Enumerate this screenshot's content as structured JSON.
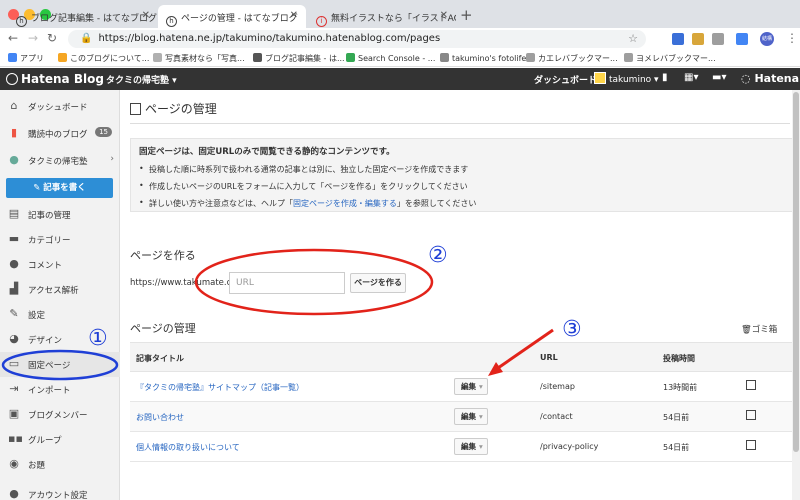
{
  "browser": {
    "tabs": [
      {
        "title": "ブログ記事編集 - はてなブログ",
        "active": false
      },
      {
        "title": "ページの管理 - はてなブログ",
        "active": true
      },
      {
        "title": "無料イラストなら「イラストAC」",
        "active": false
      }
    ],
    "url": "https://blog.hatena.ne.jp/takumino/takumino.hatenablog.com/pages",
    "bookmarks": [
      "アプリ",
      "このブログについて...",
      "写真素材なら「写真...",
      "ブログ記事編集 - は...",
      "Search Console - ...",
      "takumino's fotolife",
      "カエレバブックマー...",
      "ヨメレバブックマー..."
    ],
    "avatar_text": "結構"
  },
  "header": {
    "logo": "Hatena Blog",
    "blog_name": "タクミの帰宅塾",
    "dashboard": "ダッシュボード",
    "user": "takumino",
    "brand": "Hatena"
  },
  "sidebar": {
    "items": [
      {
        "label": "ダッシュボード",
        "icon": "home-icon"
      },
      {
        "label": "購読中のブログ",
        "icon": "bookmark-icon",
        "badge": "15"
      },
      {
        "label": "タクミの帰宅塾",
        "icon": "blog-icon"
      },
      {
        "label": "記事の管理",
        "icon": "document-icon"
      },
      {
        "label": "カテゴリー",
        "icon": "folder-icon"
      },
      {
        "label": "コメント",
        "icon": "comment-icon"
      },
      {
        "label": "アクセス解析",
        "icon": "chart-icon"
      },
      {
        "label": "設定",
        "icon": "wrench-icon"
      },
      {
        "label": "デザイン",
        "icon": "palette-icon"
      },
      {
        "label": "固定ページ",
        "icon": "page-icon"
      },
      {
        "label": "インポート",
        "icon": "import-icon"
      },
      {
        "label": "ブログメンバー",
        "icon": "members-icon"
      },
      {
        "label": "グループ",
        "icon": "group-icon"
      },
      {
        "label": "お題",
        "icon": "topic-icon"
      },
      {
        "label": "アカウント設定",
        "icon": "account-icon"
      }
    ],
    "write_button": "記事を書く"
  },
  "main": {
    "title": "ページの管理",
    "info": {
      "lead": "固定ページは、固定URLのみで閲覧できる静的なコンテンツです。",
      "bullet1": "投稿した順に時系列で扱われる通常の記事とは別に、独立した固定ページを作成できます",
      "bullet2": "作成したいページのURLをフォームに入力して「ページを作る」をクリックしてください",
      "bullet3_pre": "詳しい使い方や注意点などは、ヘルプ「",
      "bullet3_link": "固定ページを作成・編集する",
      "bullet3_post": "」を参照してください"
    },
    "create": {
      "heading": "ページを作る",
      "url_prefix": "https://www.takumate.com/",
      "placeholder": "URL",
      "button": "ページを作る"
    },
    "manage": {
      "heading": "ページの管理",
      "trash": "ゴミ箱",
      "columns": {
        "title": "記事タイトル",
        "url": "URL",
        "time": "投稿時間"
      },
      "rows": [
        {
          "title": "『タクミの帰宅塾』サイトマップ（記事一覧）",
          "edit": "編集",
          "url": "/sitemap",
          "time": "13時間前"
        },
        {
          "title": "お問い合わせ",
          "edit": "編集",
          "url": "/contact",
          "time": "54日前"
        },
        {
          "title": "個人情報の取り扱いについて",
          "edit": "編集",
          "url": "/privacy-policy",
          "time": "54日前"
        }
      ]
    }
  },
  "annotations": {
    "n1": "①",
    "n2": "②",
    "n3": "③",
    "color_red": "#e2231a",
    "color_blue": "#1f3fd6"
  }
}
